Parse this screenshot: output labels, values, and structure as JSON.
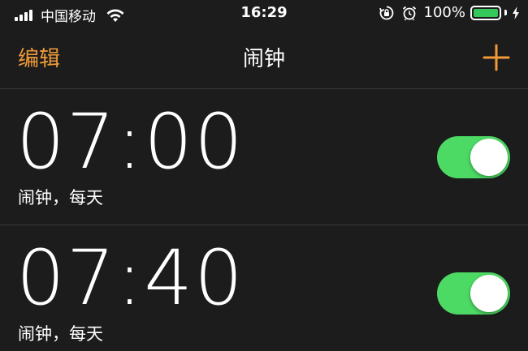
{
  "status_bar": {
    "carrier": "中国移动",
    "time": "16:29",
    "battery_percent": "100%",
    "battery_level": 1.0,
    "icons": [
      "signal-icon",
      "wifi-icon",
      "orientation-lock-icon",
      "alarm-clock-icon",
      "battery-icon",
      "charging-bolt-icon"
    ]
  },
  "nav": {
    "edit_label": "编辑",
    "title": "闹钟",
    "add_icon": "plus-icon"
  },
  "colors": {
    "accent": "#f09a37",
    "toggle_on": "#4cd964",
    "background": "#1c1c1c",
    "separator": "#3a3a3a",
    "battery": "#34c759"
  },
  "alarms": [
    {
      "time": "07:00",
      "label": "闹钟，每天",
      "enabled": true
    },
    {
      "time": "07:40",
      "label": "闹钟，每天",
      "enabled": true
    }
  ]
}
